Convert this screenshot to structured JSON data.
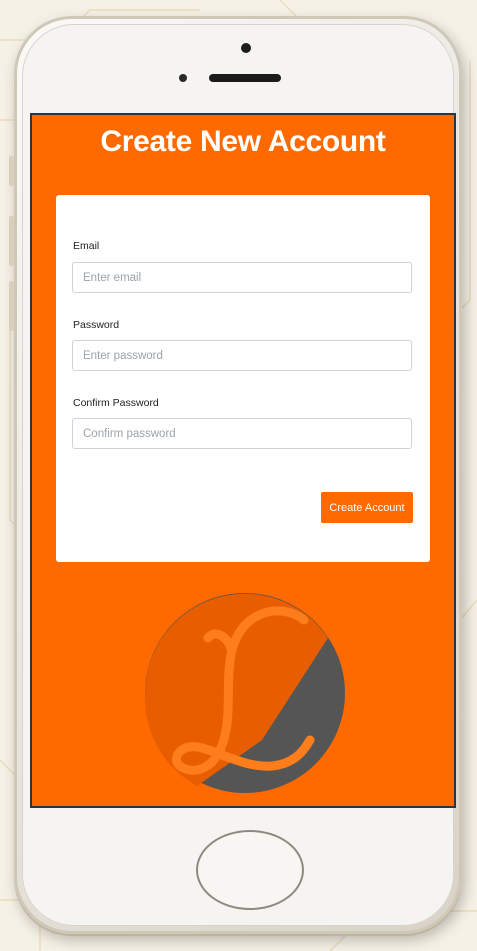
{
  "screen": {
    "title": "Create New Account",
    "background_color": "#ff6a00"
  },
  "form": {
    "email": {
      "label": "Email",
      "placeholder": "Enter email",
      "value": ""
    },
    "password": {
      "label": "Password",
      "placeholder": "Enter password",
      "value": ""
    },
    "confirm_password": {
      "label": "Confirm Password",
      "placeholder": "Confirm password",
      "value": ""
    },
    "submit_label": "Create Account",
    "accent_color": "#ff6a00"
  },
  "logo": {
    "icon": "letter-l-logo",
    "letter": "L"
  }
}
